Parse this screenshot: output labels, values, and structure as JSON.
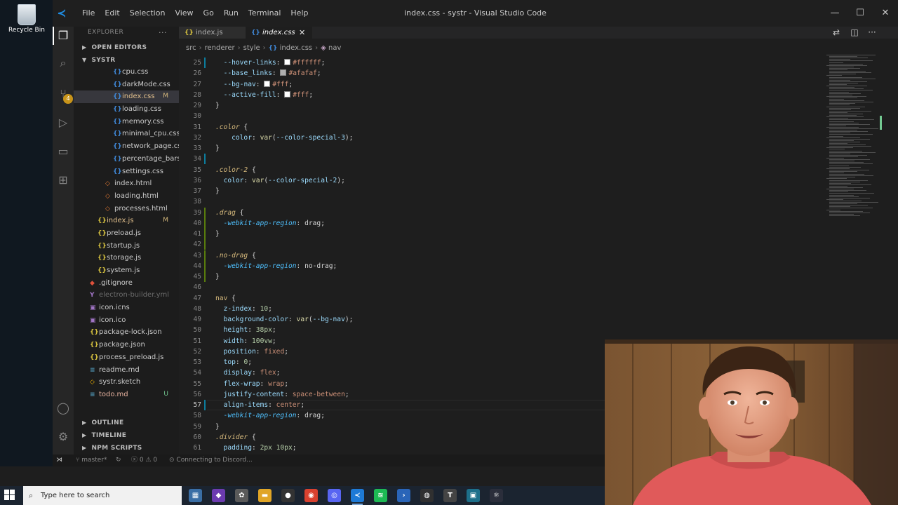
{
  "desktop": {
    "recycle_bin_label": "Recycle Bin"
  },
  "window": {
    "title": "index.css - systr - Visual Studio Code",
    "menu": [
      "File",
      "Edit",
      "Selection",
      "View",
      "Go",
      "Run",
      "Terminal",
      "Help"
    ]
  },
  "activity_bar": {
    "scm_badge": "4"
  },
  "sidebar": {
    "header": "EXPLORER",
    "more": "···",
    "open_editors": "OPEN EDITORS",
    "project": "SYSTR",
    "files": [
      {
        "name": "cpu.css",
        "icon": "css",
        "indent": 2
      },
      {
        "name": "darkMode.css",
        "icon": "css",
        "indent": 2
      },
      {
        "name": "index.css",
        "icon": "css",
        "indent": 2,
        "status": "M",
        "selected": true
      },
      {
        "name": "loading.css",
        "icon": "css",
        "indent": 2
      },
      {
        "name": "memory.css",
        "icon": "css",
        "indent": 2
      },
      {
        "name": "minimal_cpu.css",
        "icon": "css",
        "indent": 2
      },
      {
        "name": "network_page.css",
        "icon": "css",
        "indent": 2
      },
      {
        "name": "percentage_bars.css",
        "icon": "css",
        "indent": 2
      },
      {
        "name": "settings.css",
        "icon": "css",
        "indent": 2
      },
      {
        "name": "index.html",
        "icon": "html",
        "indent": 1
      },
      {
        "name": "loading.html",
        "icon": "html",
        "indent": 1
      },
      {
        "name": "processes.html",
        "icon": "html",
        "indent": 1
      },
      {
        "name": "index.js",
        "icon": "js",
        "indent": 0,
        "status": "M"
      },
      {
        "name": "preload.js",
        "icon": "js",
        "indent": 0
      },
      {
        "name": "startup.js",
        "icon": "js",
        "indent": 0
      },
      {
        "name": "storage.js",
        "icon": "js",
        "indent": 0
      },
      {
        "name": "system.js",
        "icon": "js",
        "indent": 0
      },
      {
        "name": ".gitignore",
        "icon": "git",
        "indent": -1
      },
      {
        "name": "electron-builder.yml",
        "icon": "yml",
        "indent": -1,
        "ignored": true
      },
      {
        "name": "icon.icns",
        "icon": "ico",
        "indent": -1
      },
      {
        "name": "icon.ico",
        "icon": "ico",
        "indent": -1
      },
      {
        "name": "package-lock.json",
        "icon": "json",
        "indent": -1
      },
      {
        "name": "package.json",
        "icon": "json",
        "indent": -1
      },
      {
        "name": "process_preload.js",
        "icon": "js",
        "indent": -1
      },
      {
        "name": "readme.md",
        "icon": "md",
        "indent": -1
      },
      {
        "name": "systr.sketch",
        "icon": "sk",
        "indent": -1
      },
      {
        "name": "todo.md",
        "icon": "md",
        "indent": -1,
        "status": "U"
      }
    ],
    "outline": "OUTLINE",
    "timeline": "TIMELINE",
    "npm_scripts": "NPM SCRIPTS"
  },
  "tabs": [
    {
      "label": "index.js",
      "icon": "{}"
    },
    {
      "label": "index.css",
      "icon": "{}",
      "active": true
    }
  ],
  "breadcrumb": [
    "src",
    "renderer",
    "style",
    "index.css",
    "nav"
  ],
  "code_lines": [
    {
      "n": 25,
      "html": "  <span class=\"t-prop\">--hover-links</span><span class=\"t-punc\">: </span><span class=\"swatch\" style=\"background:#ffffff\"></span><span class=\"t-val\">#ffffff</span><span class=\"t-punc\">;</span>",
      "g": "mod"
    },
    {
      "n": 26,
      "html": "  <span class=\"t-prop\">--base_links</span><span class=\"t-punc\">: </span><span class=\"swatch\" style=\"background:#afafaf\"></span><span class=\"t-val\">#afafaf</span><span class=\"t-punc\">;</span>"
    },
    {
      "n": 27,
      "html": "  <span class=\"t-prop\">--bg-nav</span><span class=\"t-punc\">: </span><span class=\"swatch\" style=\"background:#ffffff\"></span><span class=\"t-val\">#fff</span><span class=\"t-punc\">;</span>"
    },
    {
      "n": 28,
      "html": "  <span class=\"t-prop\">--active-fill</span><span class=\"t-punc\">: </span><span class=\"swatch\" style=\"background:#ffffff\"></span><span class=\"t-val\">#fff</span><span class=\"t-punc\">;</span>"
    },
    {
      "n": 29,
      "html": "<span class=\"t-punc\">}</span>"
    },
    {
      "n": 30,
      "html": ""
    },
    {
      "n": 31,
      "html": "<span class=\"t-sel-it\">.color</span><span class=\"t-punc\"> {</span>"
    },
    {
      "n": 32,
      "html": "    <span class=\"t-prop\">color</span><span class=\"t-punc\">: </span><span class=\"t-func\">var</span><span class=\"t-punc\">(</span><span class=\"t-prop\">--color-special-3</span><span class=\"t-punc\">);</span>"
    },
    {
      "n": 33,
      "html": "<span class=\"t-punc\">}</span>"
    },
    {
      "n": 34,
      "html": "",
      "g": "mod"
    },
    {
      "n": 35,
      "html": "<span class=\"t-sel-it\">.color-2</span><span class=\"t-punc\"> {</span>"
    },
    {
      "n": 36,
      "html": "  <span class=\"t-prop\">color</span><span class=\"t-punc\">: </span><span class=\"t-func\">var</span><span class=\"t-punc\">(</span><span class=\"t-prop\">--color-special-2</span><span class=\"t-punc\">);</span>"
    },
    {
      "n": 37,
      "html": "<span class=\"t-punc\">}</span>"
    },
    {
      "n": 38,
      "html": ""
    },
    {
      "n": 39,
      "html": "<span class=\"t-sel-it\">.drag</span><span class=\"t-punc\"> {</span>",
      "g": "add"
    },
    {
      "n": 40,
      "html": "  <span class=\"t-vendor\">-webkit-app-region</span><span class=\"t-punc\">: </span><span class=\"t-punc\">drag;</span>",
      "g": "add"
    },
    {
      "n": 41,
      "html": "<span class=\"t-punc\">}</span>",
      "g": "add"
    },
    {
      "n": 42,
      "html": "",
      "g": "add"
    },
    {
      "n": 43,
      "html": "<span class=\"t-sel-it\">.no-drag</span><span class=\"t-punc\"> {</span>",
      "g": "add"
    },
    {
      "n": 44,
      "html": "  <span class=\"t-vendor\">-webkit-app-region</span><span class=\"t-punc\">: </span><span class=\"t-punc\">no-drag;</span>",
      "g": "add"
    },
    {
      "n": 45,
      "html": "<span class=\"t-punc\">}</span>",
      "g": "add"
    },
    {
      "n": 46,
      "html": ""
    },
    {
      "n": 47,
      "html": "<span class=\"t-tag\">nav</span><span class=\"t-punc\"> {</span>"
    },
    {
      "n": 48,
      "html": "  <span class=\"t-prop\">z-index</span><span class=\"t-punc\">: </span><span class=\"t-num\">10</span><span class=\"t-punc\">;</span>"
    },
    {
      "n": 49,
      "html": "  <span class=\"t-prop\">background-color</span><span class=\"t-punc\">: </span><span class=\"t-func\">var</span><span class=\"t-punc\">(</span><span class=\"t-prop\">--bg-nav</span><span class=\"t-punc\">);</span>"
    },
    {
      "n": 50,
      "html": "  <span class=\"t-prop\">height</span><span class=\"t-punc\">: </span><span class=\"t-num\">38px</span><span class=\"t-punc\">;</span>"
    },
    {
      "n": 51,
      "html": "  <span class=\"t-prop\">width</span><span class=\"t-punc\">: </span><span class=\"t-num\">100vw</span><span class=\"t-punc\">;</span>"
    },
    {
      "n": 52,
      "html": "  <span class=\"t-prop\">position</span><span class=\"t-punc\">: </span><span class=\"t-val\">fixed</span><span class=\"t-punc\">;</span>"
    },
    {
      "n": 53,
      "html": "  <span class=\"t-prop\">top</span><span class=\"t-punc\">: </span><span class=\"t-num\">0</span><span class=\"t-punc\">;</span>"
    },
    {
      "n": 54,
      "html": "  <span class=\"t-prop\">display</span><span class=\"t-punc\">: </span><span class=\"t-val\">flex</span><span class=\"t-punc\">;</span>"
    },
    {
      "n": 55,
      "html": "  <span class=\"t-prop\">flex-wrap</span><span class=\"t-punc\">: </span><span class=\"t-val\">wrap</span><span class=\"t-punc\">;</span>"
    },
    {
      "n": 56,
      "html": "  <span class=\"t-prop\">justify-content</span><span class=\"t-punc\">: </span><span class=\"t-val\">space-between</span><span class=\"t-punc\">;</span>"
    },
    {
      "n": 57,
      "html": "  <span class=\"t-prop\">align-items</span><span class=\"t-punc\">: </span><span class=\"t-val\">center</span><span class=\"t-punc\">;</span>",
      "current": true,
      "g": "mod"
    },
    {
      "n": 58,
      "html": "  <span class=\"t-vendor\">-webkit-app-region</span><span class=\"t-punc\">: </span><span class=\"t-punc\">drag;</span>"
    },
    {
      "n": 59,
      "html": "<span class=\"t-punc\">}</span>"
    },
    {
      "n": 60,
      "html": "<span class=\"t-sel-it\">.divider</span><span class=\"t-punc\"> {</span>"
    },
    {
      "n": 61,
      "html": "  <span class=\"t-prop\">padding</span><span class=\"t-punc\">: </span><span class=\"t-num\">2px 10px</span><span class=\"t-punc\">;</span>"
    }
  ],
  "status_bar": {
    "branch": "master*",
    "errors": "0",
    "warnings": "0",
    "discord": "Connecting to Discord..."
  },
  "taskbar": {
    "search_placeholder": "Type here to search",
    "apps": [
      {
        "name": "file-explorer-app",
        "color": "#3a6ea5",
        "glyph": "▦"
      },
      {
        "name": "visual-studio-app",
        "color": "#6c3bb0",
        "glyph": "◆"
      },
      {
        "name": "settings-app",
        "color": "#5a5a5a",
        "glyph": "✿"
      },
      {
        "name": "folder-app",
        "color": "#e0a526",
        "glyph": "▬"
      },
      {
        "name": "github-app",
        "color": "#333333",
        "glyph": "●"
      },
      {
        "name": "chrome-app",
        "color": "#d9412f",
        "glyph": "◉"
      },
      {
        "name": "discord-app",
        "color": "#5865f2",
        "glyph": "◎"
      },
      {
        "name": "vscode-app",
        "color": "#1e7ad6",
        "glyph": "≺",
        "active": true
      },
      {
        "name": "spotify-app",
        "color": "#1db954",
        "glyph": "≋"
      },
      {
        "name": "powershell-app",
        "color": "#2a65b8",
        "glyph": "›"
      },
      {
        "name": "obs-app",
        "color": "#303030",
        "glyph": "◍"
      },
      {
        "name": "typora-app",
        "color": "#444444",
        "glyph": "T"
      },
      {
        "name": "image-app",
        "color": "#1d6f8a",
        "glyph": "▣"
      },
      {
        "name": "electron-app",
        "color": "#2b2e3b",
        "glyph": "⚛"
      }
    ]
  }
}
